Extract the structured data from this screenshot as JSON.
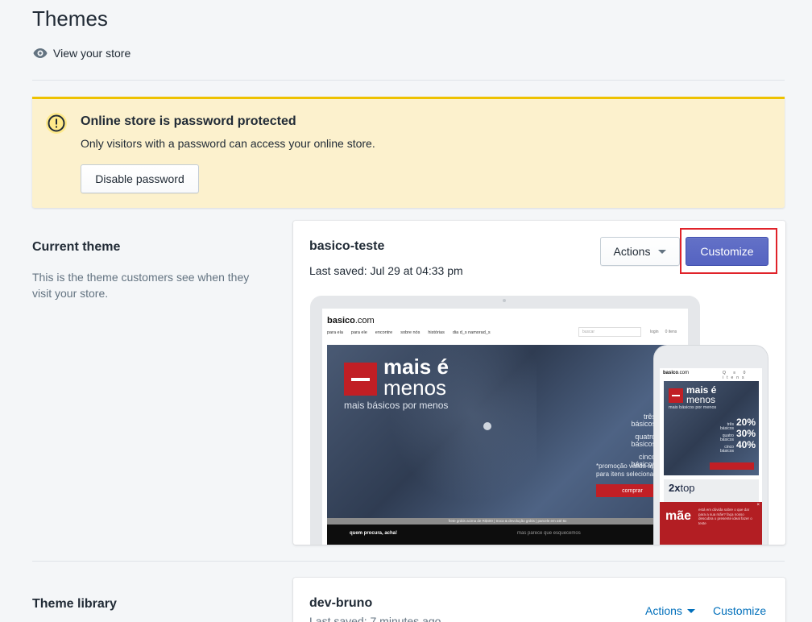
{
  "page": {
    "title": "Themes",
    "view_store_label": "View your store"
  },
  "banner": {
    "title": "Online store is password protected",
    "text": "Only visitors with a password can access your online store.",
    "button_label": "Disable password",
    "accent_color": "#eec200"
  },
  "current_theme": {
    "section_title": "Current theme",
    "section_description": "This is the theme customers see when they visit your store.",
    "name": "basico-teste",
    "last_saved": "Last saved: Jul 29 at 04:33 pm",
    "actions_label": "Actions",
    "customize_label": "Customize",
    "primary_color": "#5c6ac4"
  },
  "preview": {
    "site_logo_bold": "basico",
    "site_logo_rest": ".com",
    "nav": [
      "para ela",
      "para ele",
      "encontre",
      "sobre nós",
      "histórias",
      "dia d_s namorad_s"
    ],
    "search_placeholder": "buscar",
    "meta": [
      "login",
      "0 itens"
    ],
    "hero_title_1": "mais é",
    "hero_title_2": "menos",
    "hero_sub": "mais básicos por menos",
    "promos": [
      {
        "label_1": "três",
        "label_2": "básicos",
        "value": "20%"
      },
      {
        "label_1": "quatro",
        "label_2": "básicos",
        "value": "30%"
      },
      {
        "label_1": "cinco",
        "label_2": "básicos",
        "value": "40%"
      }
    ],
    "promo_note_1": "*promoção válida apenas",
    "promo_note_2": "para itens selecionados",
    "promo_button": "comprar",
    "ship_bar": "frete grátis acima de R$400 | troca & devolução grátis | parcele em até 6x",
    "footer_1": "quem procura, acha!",
    "footer_2": "mas parece que esquecemos",
    "phone_icons": "Q ≡ 0 itens",
    "phone_sub": "mais básicos por menos",
    "phone_2x": "2x",
    "phone_top": "top",
    "phone_mae": "mãe",
    "phone_modal_text": "está em dúvida sobre o que dar para a sua mãe? faça nosso descubra o presente ideal fazer o teste",
    "phone_close": "×"
  },
  "theme_library": {
    "section_title": "Theme library",
    "name": "dev-bruno",
    "last_saved": "Last saved: 7 minutes ago",
    "actions_label": "Actions",
    "customize_label": "Customize",
    "link_color": "#006fbb"
  }
}
